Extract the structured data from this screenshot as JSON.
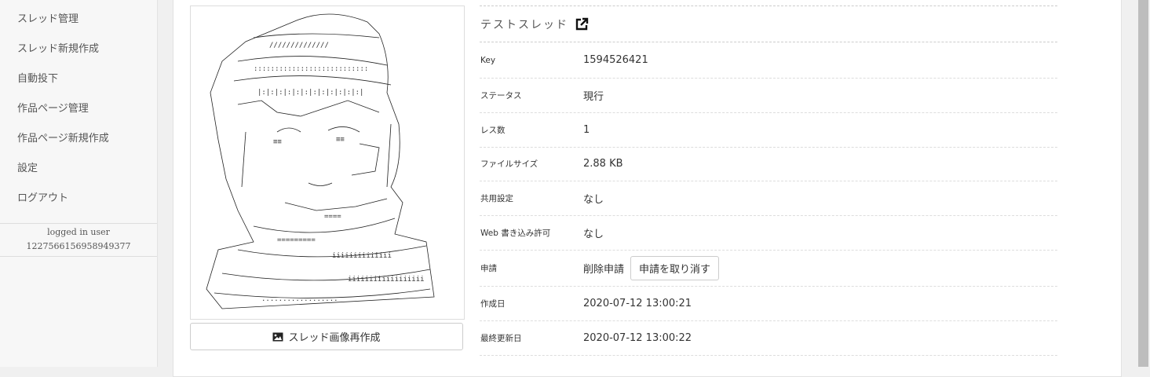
{
  "sidebar": {
    "items": [
      {
        "label": "スレッド管理"
      },
      {
        "label": "スレッド新規作成"
      },
      {
        "label": "自動投下"
      },
      {
        "label": "作品ページ管理"
      },
      {
        "label": "作品ページ新規作成"
      },
      {
        "label": "設定"
      },
      {
        "label": "ログアウト"
      }
    ],
    "user_label": "logged in user",
    "user_id": "1227566156958949377"
  },
  "thread": {
    "title": "テストスレッド",
    "regen_button": "スレッド画像再作成",
    "rows": [
      {
        "key": "Key",
        "value": "1594526421"
      },
      {
        "key": "ステータス",
        "value": "現行"
      },
      {
        "key": "レス数",
        "value": "1"
      },
      {
        "key": "ファイルサイズ",
        "value": "2.88 KB"
      },
      {
        "key": "共用設定",
        "value": "なし"
      },
      {
        "key": "Web 書き込み許可",
        "value": "なし"
      }
    ],
    "request": {
      "key": "申請",
      "value": "削除申請",
      "cancel_button": "申請を取り消す"
    },
    "created": {
      "key": "作成日",
      "value": "2020-07-12 13:00:21"
    },
    "updated": {
      "key": "最終更新日",
      "value": "2020-07-12 13:00:22"
    }
  }
}
